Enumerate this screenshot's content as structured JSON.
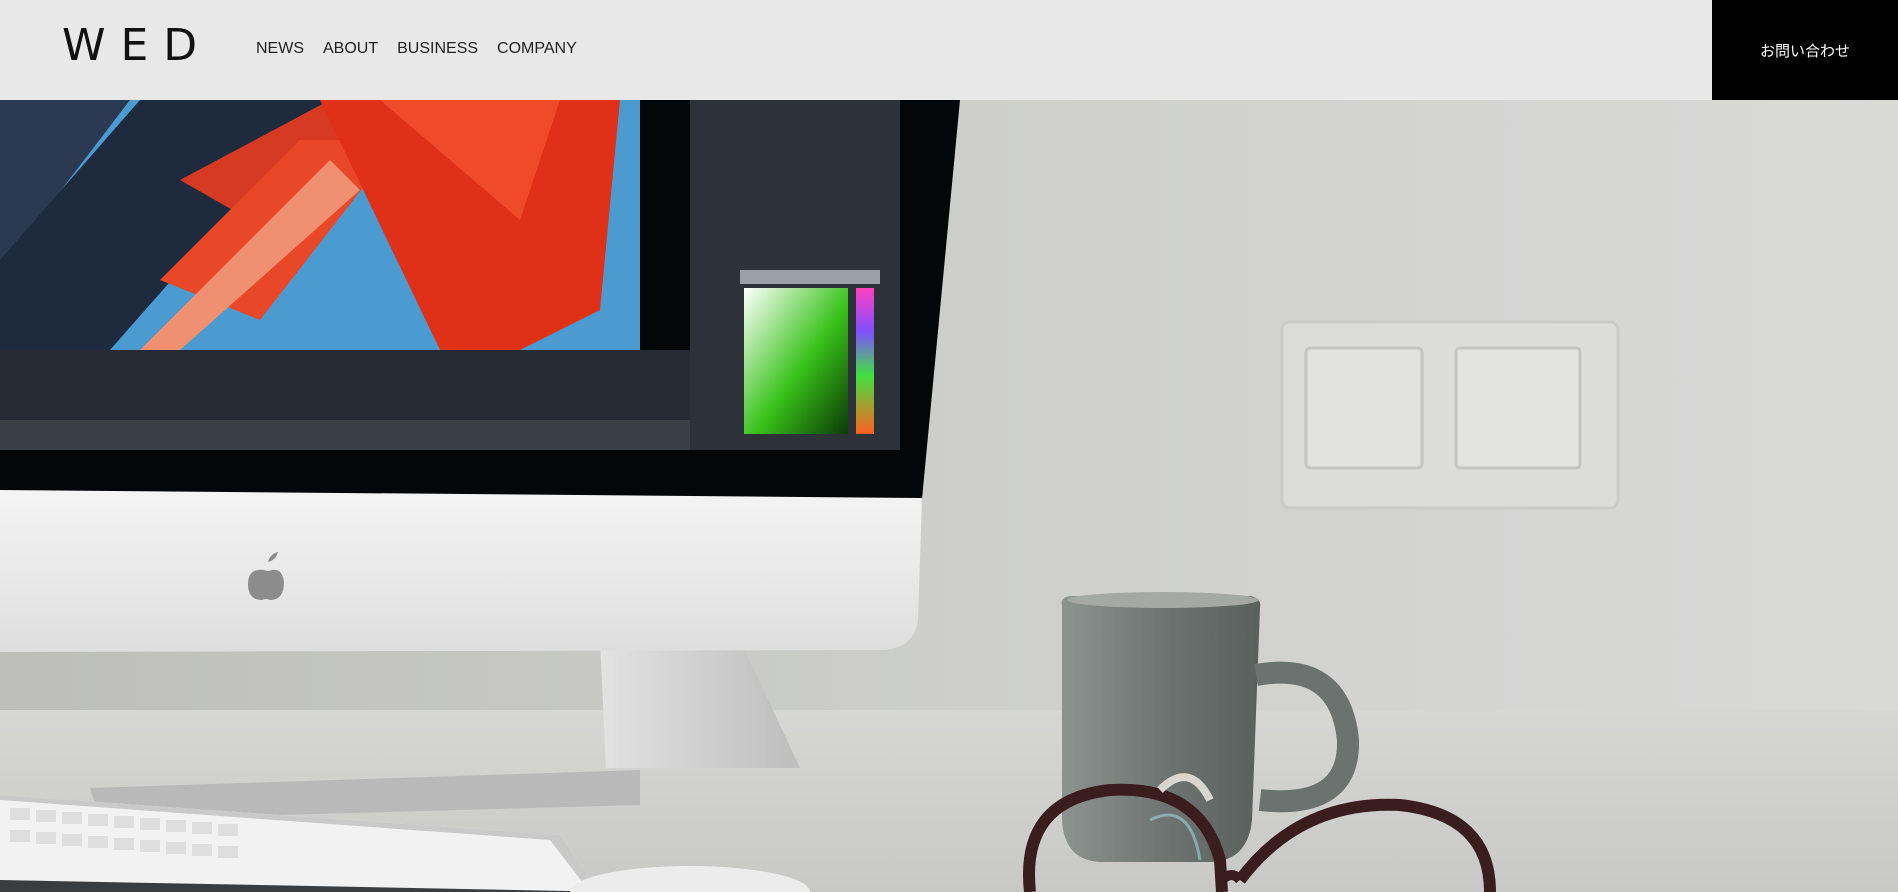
{
  "brand": {
    "logo_text": "WED"
  },
  "nav": {
    "items": [
      {
        "label": "NEWS"
      },
      {
        "label": "ABOUT"
      },
      {
        "label": "BUSINESS"
      },
      {
        "label": "COMPANY"
      }
    ]
  },
  "contact": {
    "label": "お問い合わせ"
  },
  "hero": {
    "image_icon": "hero-photo",
    "colors": {
      "header_bg": "#e8e8e8",
      "contact_bg": "#000000",
      "contact_text": "#ffffff"
    }
  }
}
